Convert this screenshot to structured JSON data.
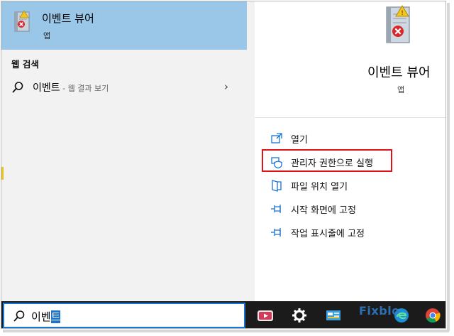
{
  "best_match": {
    "title": "이벤트 뷰어",
    "subtitle": "앱",
    "icon": "event-viewer-icon"
  },
  "web_search": {
    "header": "웹 검색",
    "query": "이벤트",
    "hint": " - 웹 결과 보기",
    "icon": "search-icon"
  },
  "detail": {
    "title": "이벤트 뷰어",
    "subtitle": "앱",
    "actions": [
      {
        "label": "열기",
        "icon": "open-icon"
      },
      {
        "label": "관리자 권한으로 실행",
        "icon": "shield-icon",
        "highlighted": true
      },
      {
        "label": "파일 위치 열기",
        "icon": "file-location-icon"
      },
      {
        "label": "시작 화면에 고정",
        "icon": "pin-icon"
      },
      {
        "label": "작업 표시줄에 고정",
        "icon": "pin-icon"
      }
    ]
  },
  "taskbar": {
    "search_text_plain": "이벤",
    "search_text_selected": "트",
    "icons": [
      "screen-recorder-icon",
      "gear-icon",
      "control-panel-icon",
      "edge-icon",
      "chrome-icon"
    ],
    "watermark": "Fixblo"
  },
  "colors": {
    "accent": "#1a74d2",
    "highlight_row": "#9ac6e8",
    "annotation_red": "#e0121a"
  }
}
